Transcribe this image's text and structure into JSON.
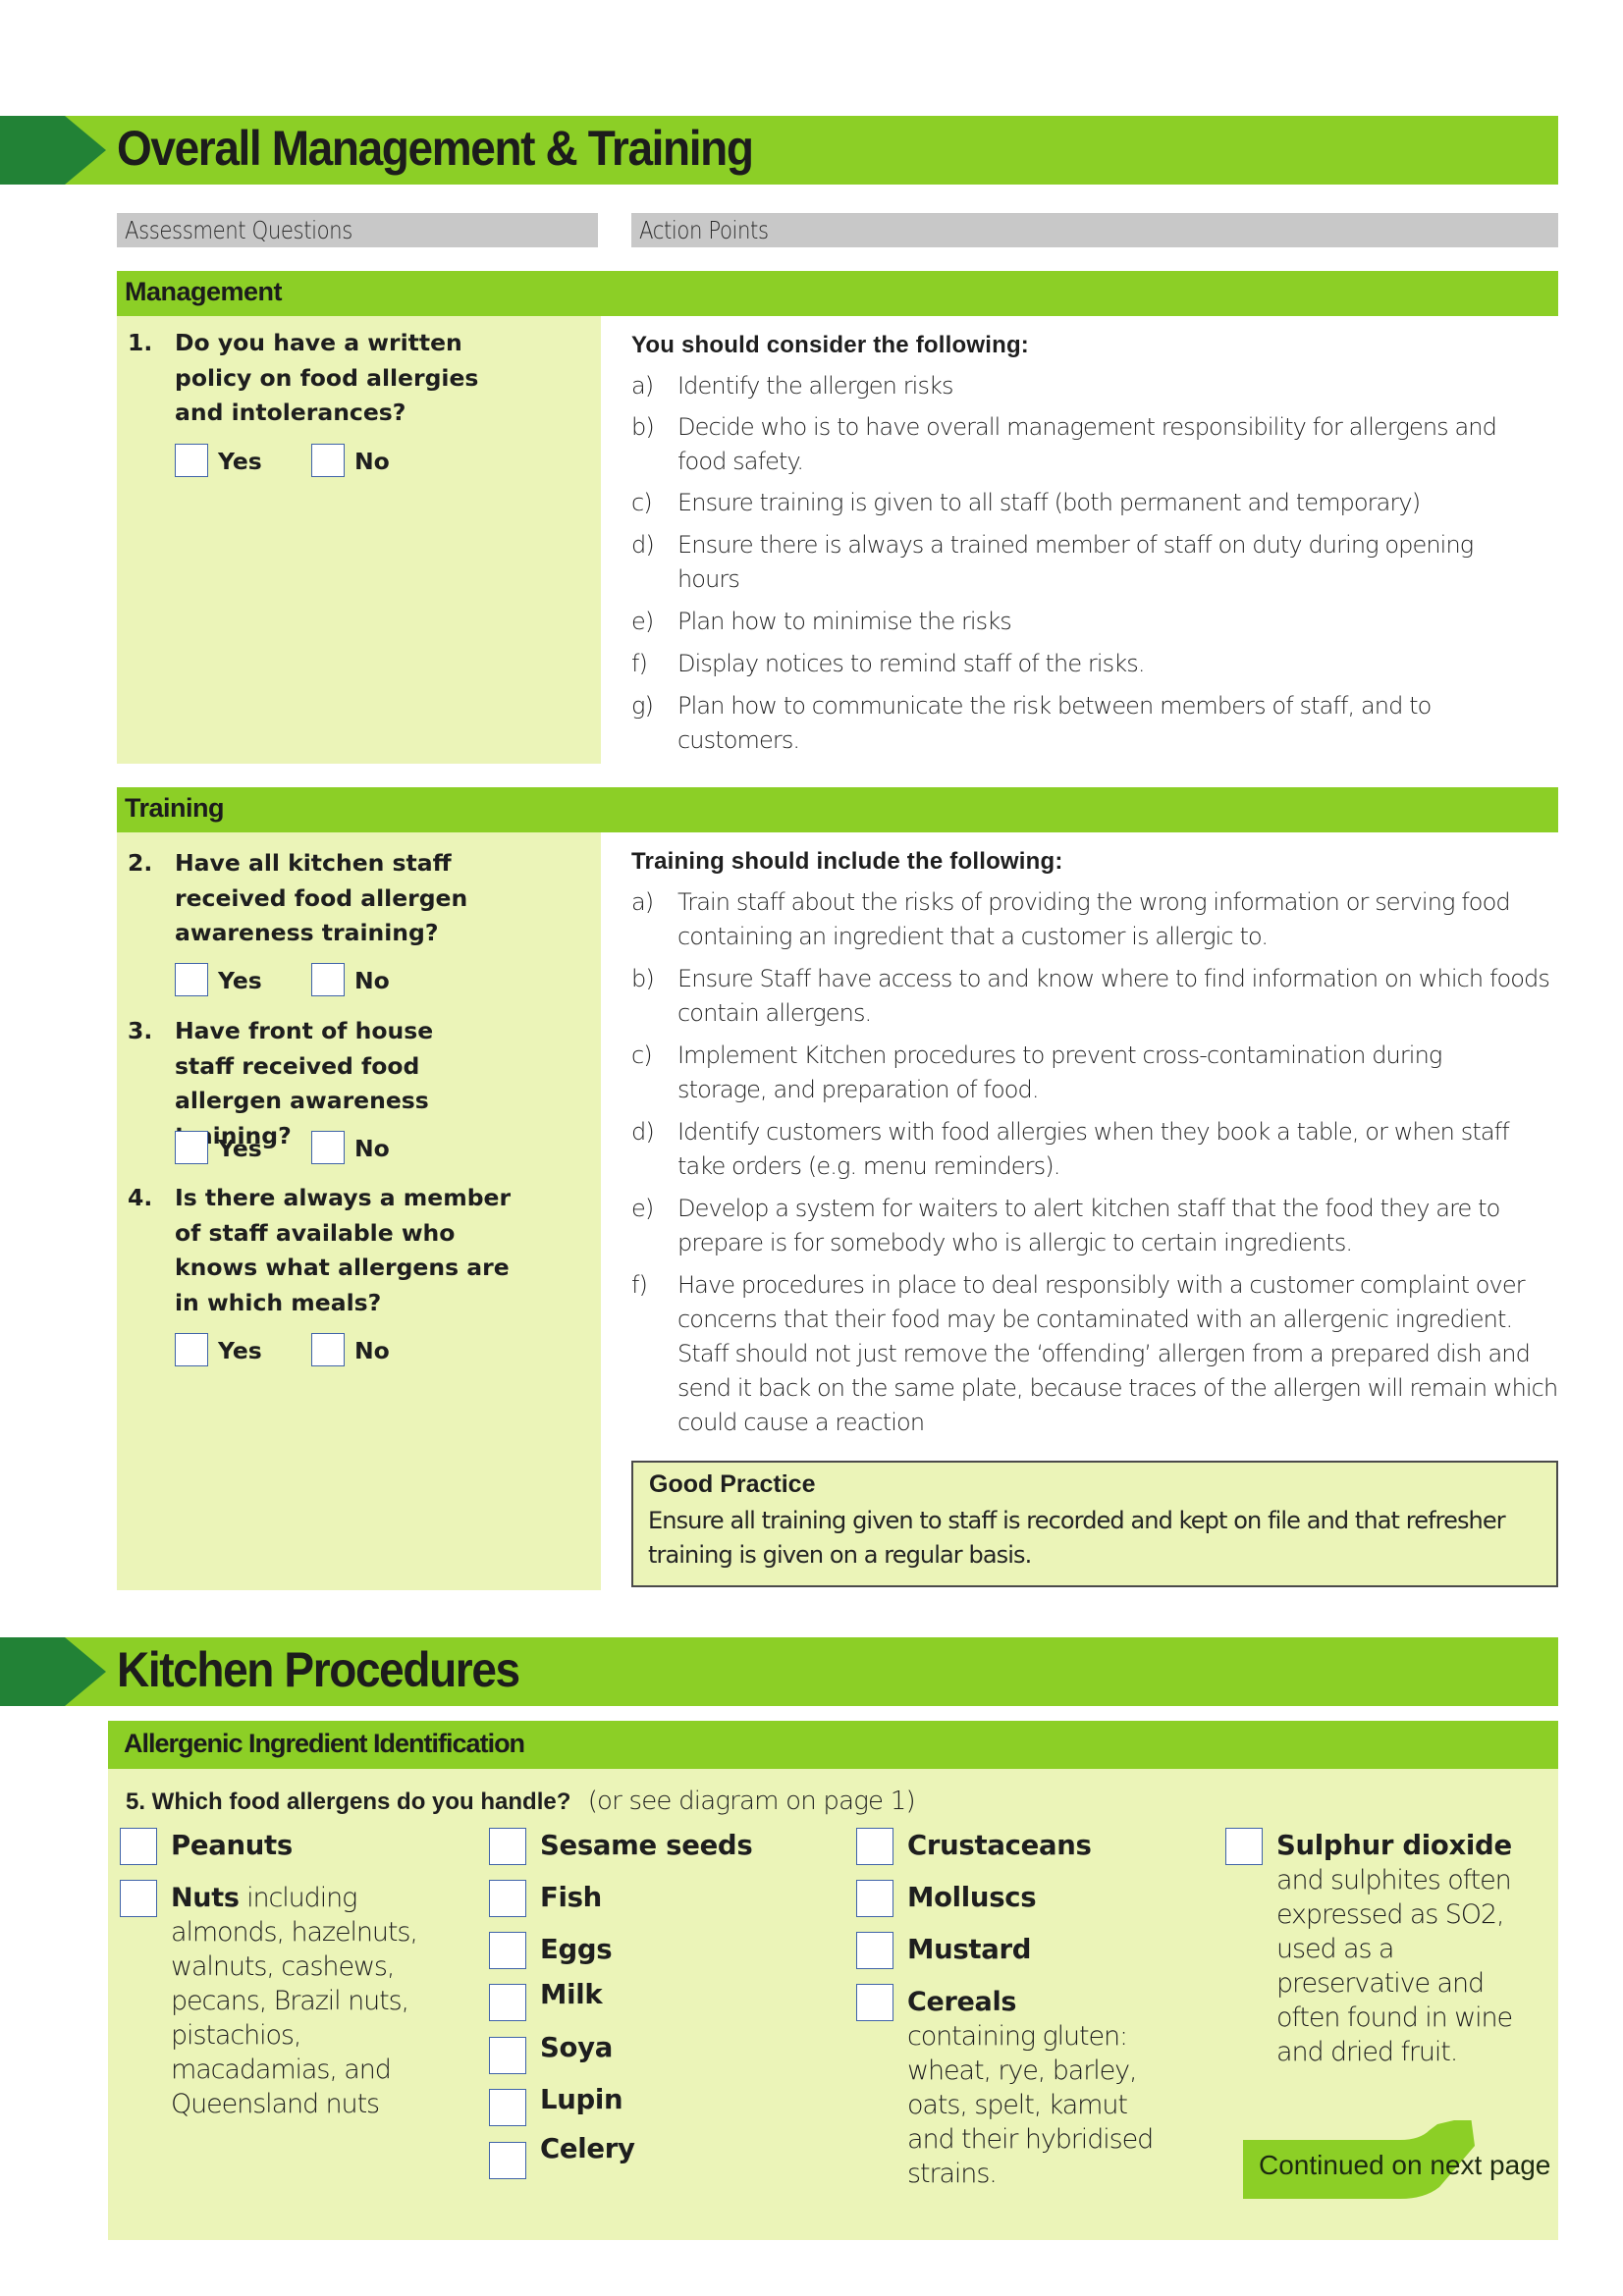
{
  "colors": {
    "banner_green": "#8ccf26",
    "arrow_dark_green": "#228236",
    "pale_panel": "#ebf4b8",
    "header_grey": "#c8c8c8",
    "checkbox_border": "#3f63a8"
  },
  "section1": {
    "title": "Overall Management & Training",
    "column_headers": {
      "left": "Assessment  Questions",
      "right": "Action Points"
    },
    "management": {
      "label": "Management",
      "questions": [
        {
          "number": "1.",
          "text": "Do you have a written policy on food allergies and intolerances?",
          "yes_label": "Yes",
          "no_label": "No",
          "yes_checked": false,
          "no_checked": false
        }
      ],
      "action_heading": "You should consider the following:",
      "action_points": [
        {
          "letter": "a)",
          "text": "Identify the allergen risks"
        },
        {
          "letter": "b)",
          "text": "Decide who is to have overall management responsibility for allergens and food safety."
        },
        {
          "letter": "c)",
          "text": "Ensure training is given to all staff (both permanent and temporary)"
        },
        {
          "letter": "d)",
          "text": "Ensure there is always a trained member of staff on duty during opening hours"
        },
        {
          "letter": "e)",
          "text": "Plan how to minimise the risks"
        },
        {
          "letter": "f)",
          "text": "Display notices to remind staff of the risks."
        },
        {
          "letter": "g)",
          "text": "Plan how to communicate the risk between members of staff, and to customers."
        }
      ]
    },
    "training": {
      "label": "Training",
      "questions": [
        {
          "number": "2.",
          "text": "Have all kitchen staff received  food  allergen awareness training?",
          "yes_label": "Yes",
          "no_label": "No",
          "yes_checked": false,
          "no_checked": false
        },
        {
          "number": "3.",
          "text": "Have front of house staff received  food  allergen awareness training?",
          "yes_label": "Yes",
          "no_label": "No",
          "yes_checked": false,
          "no_checked": false
        },
        {
          "number": "4.",
          "text": "Is there always a member of staff available who knows what allergens are in which meals?",
          "yes_label": "Yes",
          "no_label": "No",
          "yes_checked": false,
          "no_checked": false
        }
      ],
      "action_heading": "Training should include the following:",
      "action_points": [
        {
          "letter": "a)",
          "text": "Train staff about the risks of providing the wrong information or serving food containing an ingredient that a customer is allergic to."
        },
        {
          "letter": "b)",
          "text": "Ensure Staff  have access to and know where to find information on which foods contain allergens."
        },
        {
          "letter": "c)",
          "text": "Implement Kitchen procedures to prevent cross-contamination during storage, and preparation of food."
        },
        {
          "letter": "d)",
          "text": "Identify customers with food allergies when they book a table, or when staff take orders (e.g. menu reminders)."
        },
        {
          "letter": "e)",
          "text": "Develop a system for waiters to alert kitchen staff that the food they are to prepare is for somebody who is allergic to certain ingredients."
        },
        {
          "letter": "f)",
          "text": "Have procedures in place to deal responsibly with a customer complaint over concerns that their food may be contaminated with an allergenic ingredient. Staff should not just remove the ‘offending’ allergen from a prepared dish and send it back on the same plate, because traces of the allergen will remain which could cause a reaction"
        }
      ],
      "good_practice": {
        "title": "Good Practice",
        "text": "Ensure all training given to staff is recorded and kept on file and that refresher training is given on a regular basis."
      }
    }
  },
  "section2": {
    "title": "Kitchen Procedures",
    "subsection": "Allergenic Ingredient Identification",
    "question": {
      "number_and_text": "5.  Which food allergens do you handle?",
      "note": "(or see diagram on page 1)"
    },
    "allergens": [
      {
        "name": "Peanuts",
        "desc": "",
        "checked": false
      },
      {
        "name": "Nuts",
        "desc": " including almonds, hazelnuts, walnuts,  cashews, pecans, Brazil nuts, pistachios, macadamias, and Queensland  nuts",
        "checked": false
      },
      {
        "name": "Sesame seeds",
        "desc": "",
        "checked": false
      },
      {
        "name": "Fish",
        "desc": "",
        "checked": false
      },
      {
        "name": "Eggs",
        "desc": "",
        "checked": false
      },
      {
        "name": "Milk",
        "desc": "",
        "checked": false
      },
      {
        "name": "Soya",
        "desc": "",
        "checked": false
      },
      {
        "name": "Lupin",
        "desc": "",
        "checked": false
      },
      {
        "name": "Celery",
        "desc": "",
        "checked": false
      },
      {
        "name": "Crustaceans",
        "desc": "",
        "checked": false
      },
      {
        "name": "Molluscs",
        "desc": "",
        "checked": false
      },
      {
        "name": "Mustard",
        "desc": "",
        "checked": false
      },
      {
        "name": "Cereals",
        "desc": "   containing gluten: wheat, rye, barley, oats, spelt, kamut and their hybridised  strains.",
        "checked": false
      },
      {
        "name": "Sulphur dioxide",
        "desc": "and sulphites often expressed  as  SO2, used as a preservative and often found in wine and dried fruit.",
        "checked": false
      }
    ],
    "continued_label": "Continued on next page"
  }
}
